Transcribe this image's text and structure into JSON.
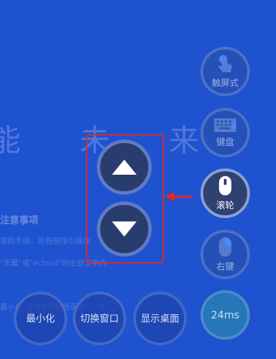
{
  "background": {
    "title": "能 未 来",
    "heading": "注意事项",
    "lines": [
      "需的手段，并按照指引操作",
      "\"天翼\"或\"ecloud\"的全部文字内",
      "最小化  没测能跟随所保护 ... 改"
    ]
  },
  "right_dock": {
    "touch_label": "触屏式",
    "keyboard_label": "键盘",
    "wheel_label": "滚轮",
    "right_click_label": "右键",
    "latency": "24ms"
  },
  "bottom_bar": {
    "minimize": "最小化",
    "switch_window": "切换窗口",
    "show_desktop": "显示桌面"
  },
  "colors": {
    "background": "#1e52cf",
    "highlight": "#e02828",
    "active_button": "#2f4170"
  },
  "icons": [
    "touch-hand-icon",
    "keyboard-icon",
    "mouse-icon",
    "right-click-mouse-icon",
    "scroll-up-icon",
    "scroll-down-icon",
    "red-pointer-arrow-icon"
  ]
}
